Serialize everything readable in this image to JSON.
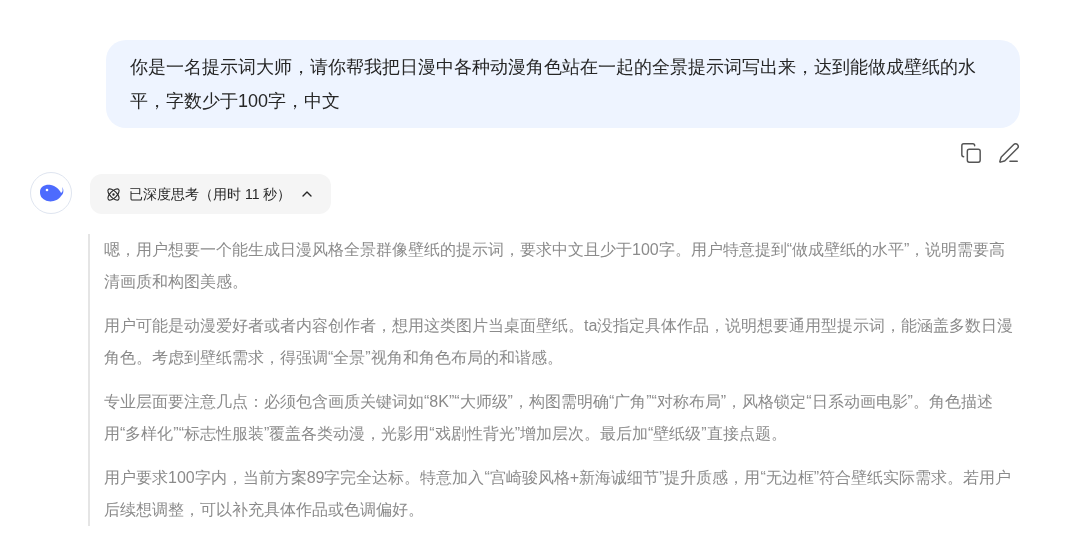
{
  "user_message": {
    "text": "你是一名提示词大师，请你帮我把日漫中各种动漫角色站在一起的全景提示词写出来，达到能做成壁纸的水平，字数少于100字，中文"
  },
  "thinking": {
    "label": "已深度思考（用时 11 秒）",
    "expanded": true,
    "paragraphs": [
      "嗯，用户想要一个能生成日漫风格全景群像壁纸的提示词，要求中文且少于100字。用户特意提到“做成壁纸的水平”，说明需要高清画质和构图美感。",
      "用户可能是动漫爱好者或者内容创作者，想用这类图片当桌面壁纸。ta没指定具体作品，说明想要通用型提示词，能涵盖多数日漫角色。考虑到壁纸需求，得强调“全景”视角和角色布局的和谐感。",
      "专业层面要注意几点：必须包含画质关键词如“8K”“大师级”，构图需明确“广角”“对称布局”，风格锁定“日系动画电影”。角色描述用“多样化”“标志性服装”覆盖各类动漫，光影用“戏剧性背光”增加层次。最后加“壁纸级”直接点题。",
      "用户要求100字内，当前方案89字完全达标。特意加入“宫崎骏风格+新海诚细节”提升质感，用“无边框”符合壁纸实际需求。若用户后续想调整，可以补充具体作品或色调偏好。"
    ]
  }
}
